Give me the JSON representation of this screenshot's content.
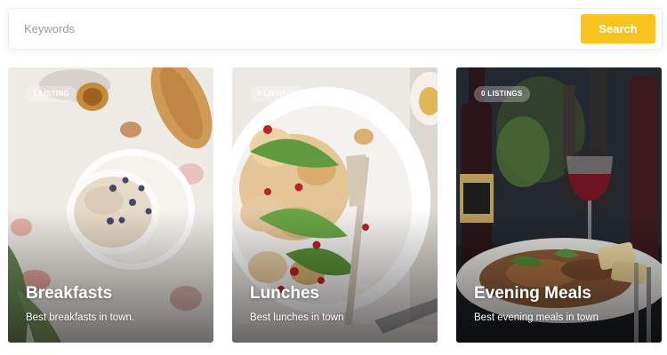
{
  "search": {
    "placeholder": "Keywords",
    "button_label": "Search",
    "accent_color": "#f9c31d"
  },
  "cards": [
    {
      "badge": "1 LISTING",
      "title": "Breakfasts",
      "subtitle": "Best breakfasts in town."
    },
    {
      "badge": "0 LISTINGS",
      "title": "Lunches",
      "subtitle": "Best lunches in town"
    },
    {
      "badge": "0 LISTINGS",
      "title": "Evening Meals",
      "subtitle": "Best evening meals in town"
    }
  ]
}
